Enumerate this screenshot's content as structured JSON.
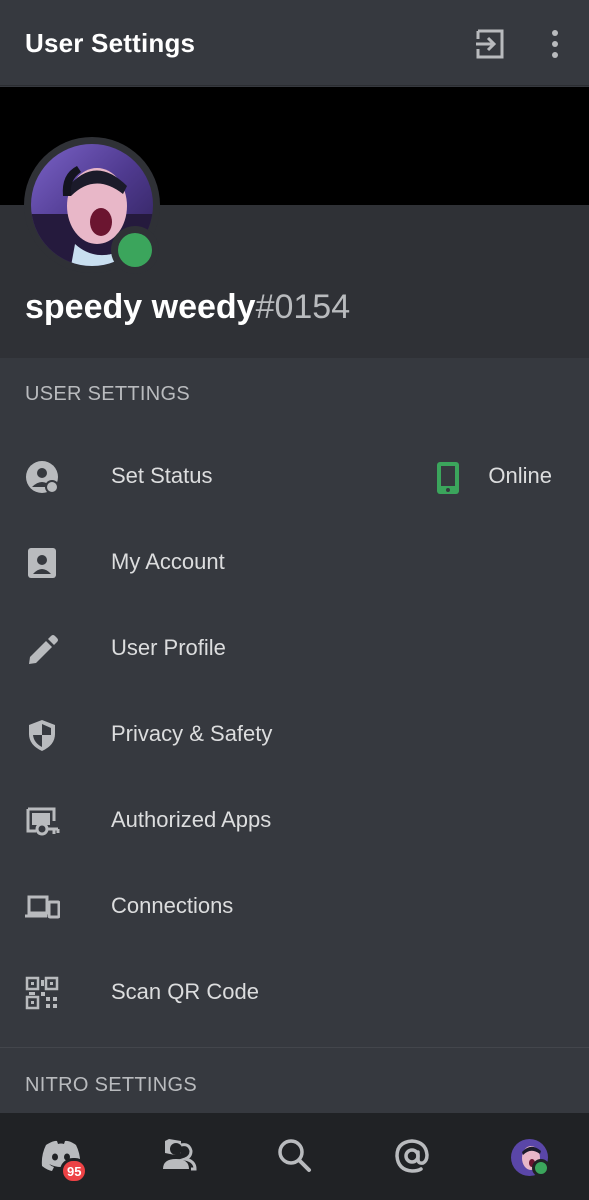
{
  "header": {
    "title": "User Settings",
    "logout_icon": "logout-icon",
    "more_icon": "kebab-menu-icon"
  },
  "profile": {
    "username": "speedy weedy",
    "discriminator": "#0154",
    "status": "online",
    "status_color": "#3ba55c"
  },
  "user_settings": {
    "header": "USER SETTINGS",
    "items": [
      {
        "label": "Set Status",
        "icon": "status-face-icon",
        "trailing_icon": "mobile-phone-icon",
        "trailing_text": "Online"
      },
      {
        "label": "My Account",
        "icon": "account-card-icon"
      },
      {
        "label": "User Profile",
        "icon": "pencil-icon"
      },
      {
        "label": "Privacy & Safety",
        "icon": "shield-icon"
      },
      {
        "label": "Authorized Apps",
        "icon": "authorized-apps-icon"
      },
      {
        "label": "Connections",
        "icon": "devices-icon"
      },
      {
        "label": "Scan QR Code",
        "icon": "qr-code-icon"
      }
    ]
  },
  "nitro_settings": {
    "header": "NITRO SETTINGS"
  },
  "bottom_nav": {
    "items": [
      {
        "name": "home",
        "icon": "discord-logo-icon",
        "badge": "95"
      },
      {
        "name": "friends",
        "icon": "friends-icon"
      },
      {
        "name": "search",
        "icon": "search-icon"
      },
      {
        "name": "mentions",
        "icon": "at-mention-icon"
      },
      {
        "name": "profile",
        "icon": "user-avatar"
      }
    ]
  },
  "colors": {
    "background": "#36393f",
    "card": "#2f3136",
    "nav": "#202225",
    "online": "#3ba55c",
    "badge": "#ed4245"
  }
}
